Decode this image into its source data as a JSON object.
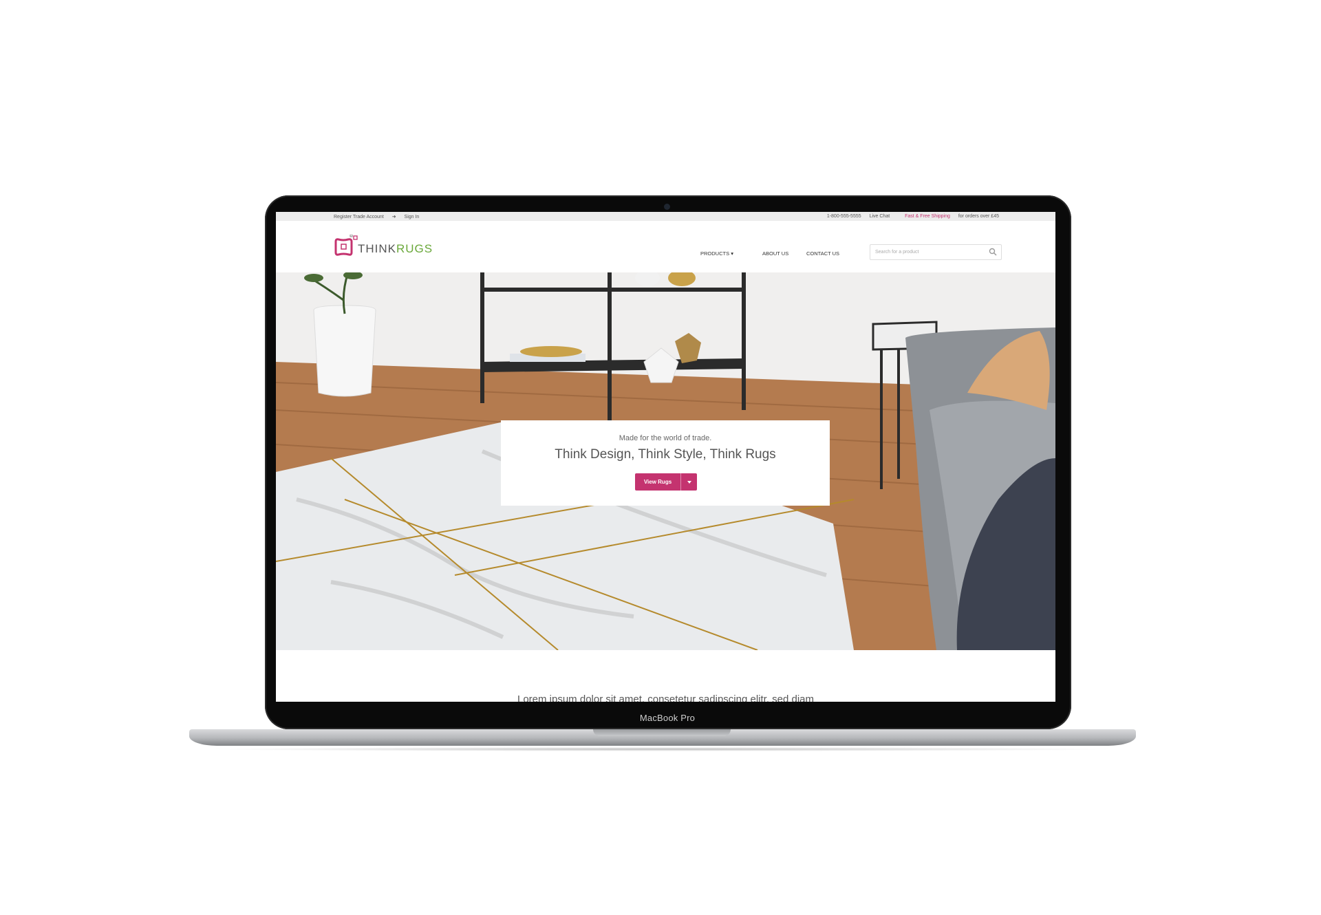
{
  "device": {
    "label": "MacBook Pro"
  },
  "topbar": {
    "register": "Register Trade Account",
    "signin": "Sign In",
    "phone": "1-800-555-5555",
    "live_chat": "Live Chat",
    "shipping_highlight": "Fast & Free Shipping",
    "shipping_rest": "for orders over £45"
  },
  "logo": {
    "think": "THINK",
    "rugs": "RUGS"
  },
  "nav": {
    "products": "PRODUCTS",
    "about": "ABOUT US",
    "contact": "CONTACT US"
  },
  "search": {
    "placeholder": "Search for a product"
  },
  "hero": {
    "subtitle": "Made for the world of trade.",
    "title": "Think Design, Think Style, Think Rugs",
    "button": "View Rugs"
  },
  "intro": {
    "text": "Lorem ipsum dolor sit amet, consetetur sadipscing elitr, sed diam"
  },
  "colors": {
    "accent": "#c4336f",
    "logo_green": "#6aa83a"
  }
}
